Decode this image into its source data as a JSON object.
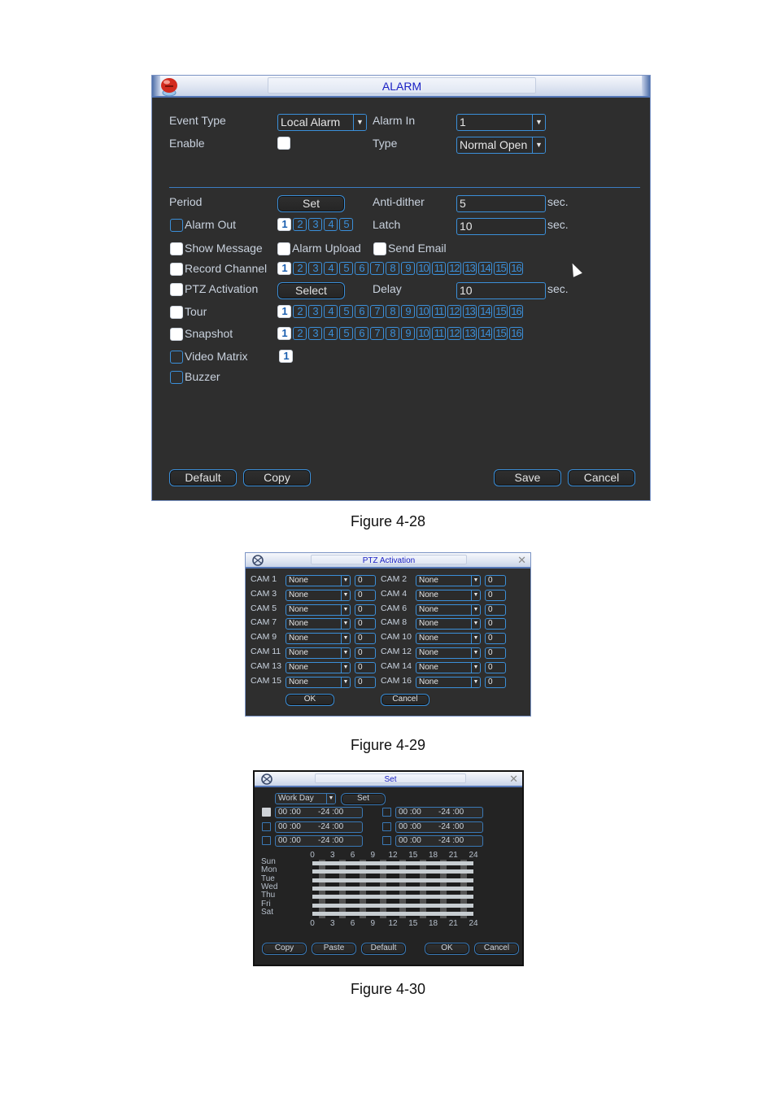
{
  "alarm_dialog": {
    "title": "ALARM",
    "event_type": {
      "label": "Event Type",
      "value": "Local Alarm"
    },
    "alarm_in": {
      "label": "Alarm In",
      "value": "1"
    },
    "enable": {
      "label": "Enable",
      "checked": false
    },
    "type": {
      "label": "Type",
      "value": "Normal Open"
    },
    "period": {
      "label": "Period",
      "button": "Set"
    },
    "anti_dither": {
      "label": "Anti-dither",
      "value": "5",
      "unit": "sec."
    },
    "alarm_out": {
      "label": "Alarm Out",
      "checked": false,
      "channels": [
        "1",
        "2",
        "3",
        "4",
        "5"
      ],
      "selected": [
        "1"
      ]
    },
    "latch": {
      "label": "Latch",
      "value": "10",
      "unit": "sec."
    },
    "show_message": {
      "label": "Show Message",
      "checked": false
    },
    "alarm_upload": {
      "label": "Alarm Upload",
      "checked": false
    },
    "send_email": {
      "label": "Send Email",
      "checked": false
    },
    "record_channel": {
      "label": "Record Channel",
      "checked": false,
      "channels": [
        "1",
        "2",
        "3",
        "4",
        "5",
        "6",
        "7",
        "8",
        "9",
        "10",
        "11",
        "12",
        "13",
        "14",
        "15",
        "16"
      ],
      "selected": [
        "1"
      ]
    },
    "ptz_activation": {
      "label": "PTZ Activation",
      "checked": false,
      "button": "Select"
    },
    "delay": {
      "label": "Delay",
      "value": "10",
      "unit": "sec."
    },
    "tour": {
      "label": "Tour",
      "checked": false,
      "channels": [
        "1",
        "2",
        "3",
        "4",
        "5",
        "6",
        "7",
        "8",
        "9",
        "10",
        "11",
        "12",
        "13",
        "14",
        "15",
        "16"
      ],
      "selected": [
        "1"
      ]
    },
    "snapshot": {
      "label": "Snapshot",
      "checked": false,
      "channels": [
        "1",
        "2",
        "3",
        "4",
        "5",
        "6",
        "7",
        "8",
        "9",
        "10",
        "11",
        "12",
        "13",
        "14",
        "15",
        "16"
      ],
      "selected": [
        "1"
      ]
    },
    "video_matrix": {
      "label": "Video Matrix",
      "checked": false,
      "channels": [
        "1"
      ],
      "selected": [
        "1"
      ]
    },
    "buzzer": {
      "label": "Buzzer",
      "checked": false
    },
    "buttons": {
      "default": "Default",
      "copy": "Copy",
      "save": "Save",
      "cancel": "Cancel"
    },
    "caption": "Figure 4-28"
  },
  "ptz_dialog": {
    "title": "PTZ Activation",
    "cams": [
      {
        "label": "CAM 1",
        "type": "None",
        "value": "0"
      },
      {
        "label": "CAM 2",
        "type": "None",
        "value": "0"
      },
      {
        "label": "CAM 3",
        "type": "None",
        "value": "0"
      },
      {
        "label": "CAM 4",
        "type": "None",
        "value": "0"
      },
      {
        "label": "CAM 5",
        "type": "None",
        "value": "0"
      },
      {
        "label": "CAM 6",
        "type": "None",
        "value": "0"
      },
      {
        "label": "CAM 7",
        "type": "None",
        "value": "0"
      },
      {
        "label": "CAM 8",
        "type": "None",
        "value": "0"
      },
      {
        "label": "CAM 9",
        "type": "None",
        "value": "0"
      },
      {
        "label": "CAM 10",
        "type": "None",
        "value": "0"
      },
      {
        "label": "CAM 11",
        "type": "None",
        "value": "0"
      },
      {
        "label": "CAM 12",
        "type": "None",
        "value": "0"
      },
      {
        "label": "CAM 13",
        "type": "None",
        "value": "0"
      },
      {
        "label": "CAM 14",
        "type": "None",
        "value": "0"
      },
      {
        "label": "CAM 15",
        "type": "None",
        "value": "0"
      },
      {
        "label": "CAM 16",
        "type": "None",
        "value": "0"
      }
    ],
    "buttons": {
      "ok": "OK",
      "cancel": "Cancel"
    },
    "caption": "Figure 4-29"
  },
  "set_dialog": {
    "title": "Set",
    "day_select": "Work Day",
    "set_button": "Set",
    "periods": [
      {
        "start": "00 :00",
        "end": "-24 :00",
        "checked": true
      },
      {
        "start": "00 :00",
        "end": "-24 :00",
        "checked": false
      },
      {
        "start": "00 :00",
        "end": "-24 :00",
        "checked": false
      },
      {
        "start": "00 :00",
        "end": "-24 :00",
        "checked": false
      },
      {
        "start": "00 :00",
        "end": "-24 :00",
        "checked": false
      },
      {
        "start": "00 :00",
        "end": "-24 :00",
        "checked": false
      }
    ],
    "days": [
      "Sun",
      "Mon",
      "Tue",
      "Wed",
      "Thu",
      "Fri",
      "Sat"
    ],
    "hour_ticks": [
      "0",
      "3",
      "6",
      "9",
      "12",
      "15",
      "18",
      "21",
      "24"
    ],
    "buttons": {
      "copy": "Copy",
      "paste": "Paste",
      "default": "Default",
      "ok": "OK",
      "cancel": "Cancel"
    },
    "caption": "Figure 4-30"
  }
}
